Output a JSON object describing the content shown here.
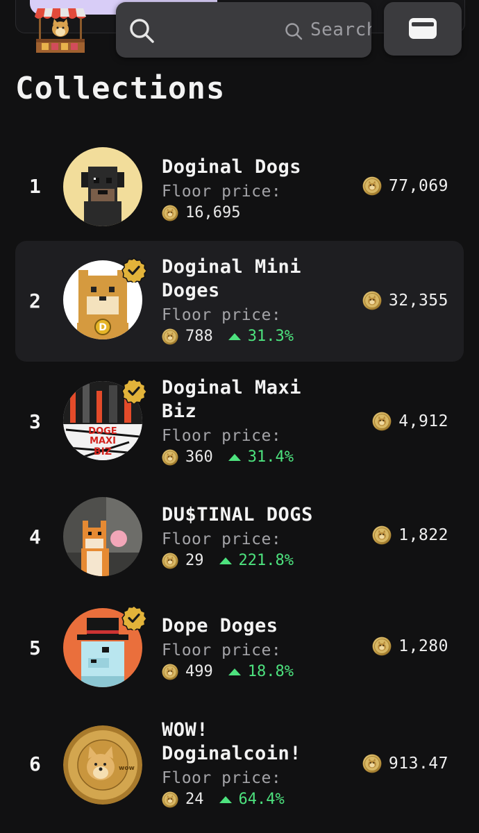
{
  "header": {
    "search_placeholder": "Search for tok",
    "logo": "doge-shop-logo",
    "wallet_icon": "wallet-icon"
  },
  "title": "Collections",
  "colors": {
    "background": "#111112",
    "positive": "#4de27e",
    "coin": "#d9b552"
  },
  "floor_label": "Floor price:",
  "collections": [
    {
      "rank": "1",
      "name_lines": [
        "Doginal Dogs"
      ],
      "verified": false,
      "floor": "16,695",
      "change": "",
      "volume": "77,069"
    },
    {
      "rank": "2",
      "name_lines": [
        "Doginal Mini",
        "Doges"
      ],
      "verified": true,
      "floor": "788",
      "change": "31.3%",
      "volume": "32,355"
    },
    {
      "rank": "3",
      "name_lines": [
        "Doginal Maxi",
        "Biz"
      ],
      "verified": true,
      "floor": "360",
      "change": "31.4%",
      "volume": "4,912"
    },
    {
      "rank": "4",
      "name_lines": [
        "DU$TINAL DOGS"
      ],
      "verified": false,
      "floor": "29",
      "change": "221.8%",
      "volume": "1,822"
    },
    {
      "rank": "5",
      "name_lines": [
        "Dope Doges"
      ],
      "verified": true,
      "floor": "499",
      "change": "18.8%",
      "volume": "1,280"
    },
    {
      "rank": "6",
      "name_lines": [
        "WOW!",
        "Doginalcoin!"
      ],
      "verified": false,
      "floor": "24",
      "change": "64.4%",
      "volume": "913.47"
    }
  ]
}
